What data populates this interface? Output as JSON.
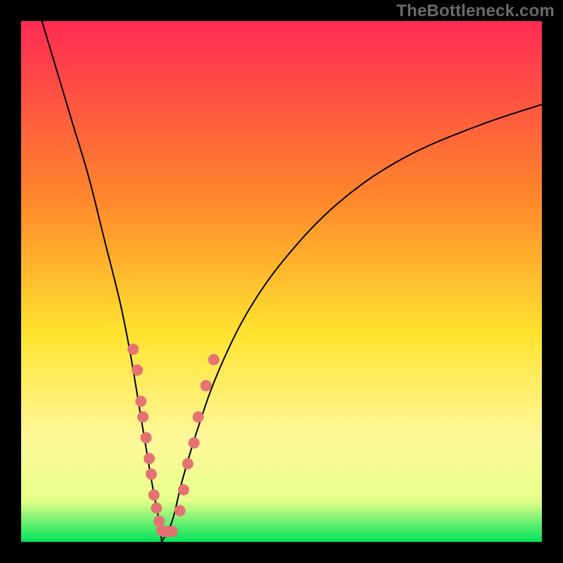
{
  "watermark": "TheBottleneck.com",
  "chart_data": {
    "type": "line",
    "title": "",
    "xlabel": "",
    "ylabel": "",
    "xlim": [
      0,
      100
    ],
    "ylim": [
      0,
      100
    ],
    "gradient_stops": [
      {
        "offset": 0,
        "color": "#ff2b53"
      },
      {
        "offset": 35,
        "color": "#ff8a2b"
      },
      {
        "offset": 60,
        "color": "#ffe330"
      },
      {
        "offset": 80,
        "color": "#fff79a"
      },
      {
        "offset": 92,
        "color": "#e6ff8a"
      },
      {
        "offset": 100,
        "color": "#00e35a"
      }
    ],
    "curve_color": "#000000",
    "curve_weight": 2,
    "minimum_x": 27,
    "left_branch": [
      {
        "x": 4,
        "y": 100
      },
      {
        "x": 7,
        "y": 90
      },
      {
        "x": 10,
        "y": 80
      },
      {
        "x": 13,
        "y": 70
      },
      {
        "x": 16,
        "y": 58
      },
      {
        "x": 19,
        "y": 46
      },
      {
        "x": 21,
        "y": 36
      },
      {
        "x": 23,
        "y": 24
      },
      {
        "x": 25,
        "y": 12
      },
      {
        "x": 26.5,
        "y": 4
      },
      {
        "x": 27,
        "y": 0
      }
    ],
    "right_branch": [
      {
        "x": 27,
        "y": 0
      },
      {
        "x": 29,
        "y": 4
      },
      {
        "x": 31,
        "y": 12
      },
      {
        "x": 34,
        "y": 22
      },
      {
        "x": 38,
        "y": 33
      },
      {
        "x": 44,
        "y": 45
      },
      {
        "x": 52,
        "y": 56
      },
      {
        "x": 62,
        "y": 66
      },
      {
        "x": 74,
        "y": 74
      },
      {
        "x": 88,
        "y": 80
      },
      {
        "x": 100,
        "y": 84
      }
    ],
    "marker_color": "#e57373",
    "marker_radius": 8,
    "markers": [
      {
        "x": 21.5,
        "y": 37
      },
      {
        "x": 22.3,
        "y": 33
      },
      {
        "x": 23.0,
        "y": 27
      },
      {
        "x": 23.4,
        "y": 24
      },
      {
        "x": 24.0,
        "y": 20
      },
      {
        "x": 24.6,
        "y": 16
      },
      {
        "x": 25.0,
        "y": 13
      },
      {
        "x": 25.5,
        "y": 9
      },
      {
        "x": 26.0,
        "y": 6.5
      },
      {
        "x": 26.5,
        "y": 4
      },
      {
        "x": 27.0,
        "y": 2.2
      },
      {
        "x": 27.5,
        "y": 2.0
      },
      {
        "x": 28.3,
        "y": 2.0
      },
      {
        "x": 29.0,
        "y": 2.0
      },
      {
        "x": 30.5,
        "y": 6
      },
      {
        "x": 31.2,
        "y": 10
      },
      {
        "x": 32.0,
        "y": 15
      },
      {
        "x": 33.2,
        "y": 19
      },
      {
        "x": 34.0,
        "y": 24
      },
      {
        "x": 35.5,
        "y": 30
      },
      {
        "x": 37.0,
        "y": 35
      }
    ]
  }
}
